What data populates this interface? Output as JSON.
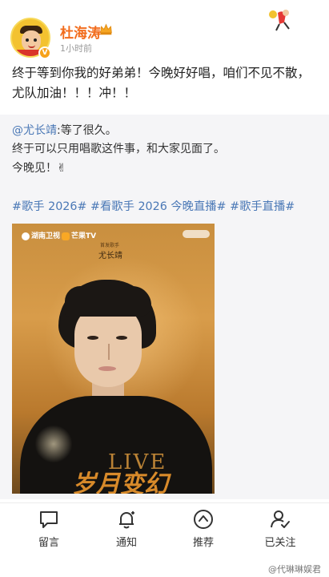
{
  "header": {
    "username": "杜海涛",
    "time": "1小时前",
    "crown_icon": "crown-icon",
    "deco_icon": "cartoon-sticker-icon"
  },
  "post": {
    "text": "终于等到你我的好弟弟！今晚好好唱，咱们不见不散，尤队加油！！！冲！！"
  },
  "repost": {
    "mention": "@尤长靖",
    "line1_rest": ":等了很久。",
    "line2": "终于可以只用唱歌这件事，和大家见面了。",
    "line3": "今晚见！✌",
    "tags": [
      "#歌手 2026#",
      "#看歌手 2026 今晚直播#",
      "#歌手直播#"
    ]
  },
  "poster": {
    "logo_hunan": "湖南卫视",
    "logo_mango": "芒果TV",
    "label": "首发歌手",
    "name": "尤长靖",
    "live": "LIVE",
    "title_art": "岁月变幻"
  },
  "bottom_nav": [
    {
      "label": "留言",
      "icon": "comment-icon"
    },
    {
      "label": "通知",
      "icon": "bell-icon"
    },
    {
      "label": "推荐",
      "icon": "up-arrow-circle-icon"
    },
    {
      "label": "已关注",
      "icon": "user-followed-icon"
    }
  ],
  "watermark": "@代琳琳娱君"
}
